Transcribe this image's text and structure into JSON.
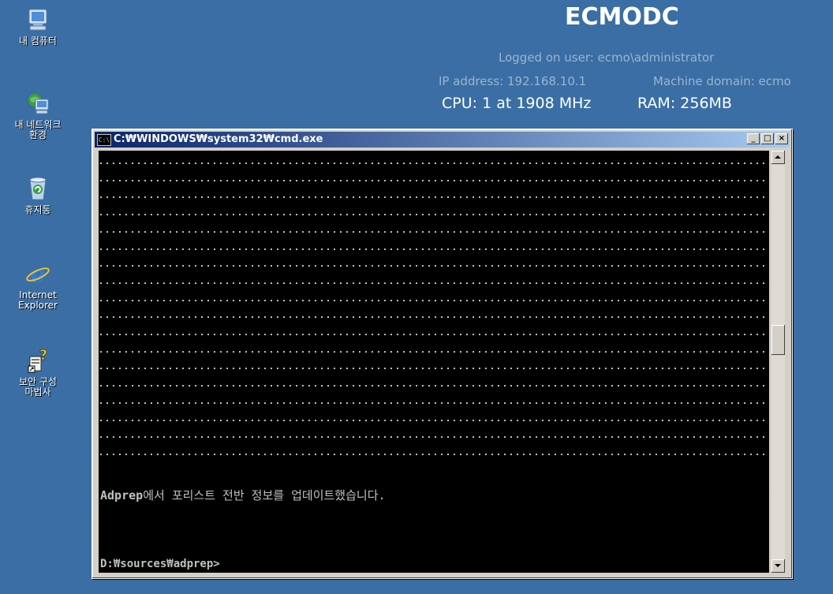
{
  "desktop": {
    "icons": [
      {
        "label": "내 컴퓨터",
        "icon": "my-computer-icon"
      },
      {
        "label": "내 네트워크\n환경",
        "icon": "network-places-icon"
      },
      {
        "label": "휴지통",
        "icon": "recycle-bin-icon"
      },
      {
        "label": "Internet\nExplorer",
        "icon": "internet-explorer-icon"
      },
      {
        "label": "보안 구성\n마법사",
        "icon": "security-wizard-icon"
      }
    ]
  },
  "bginfo": {
    "hostname": "ECMODC",
    "logged_on_user": "Logged on user: ecmo\\administrator",
    "ip_address": "IP address: 192.168.10.1",
    "machine_domain": "Machine domain: ecmo",
    "cpu": "CPU: 1 at 1908 MHz",
    "ram": "RAM: 256MB"
  },
  "window": {
    "title": "C:₩WINDOWS₩system32₩cmd.exe",
    "icon_text": "C:\\",
    "buttons": {
      "minimize": "_",
      "maximize": "□",
      "close": "×"
    }
  },
  "console": {
    "dotted_line_count": 18,
    "message_prefix": "Adprep",
    "message_text": "에서 포리스트 전반 정보를 업데이트했습니다.",
    "prompt": "D:₩sources₩adprep>"
  },
  "scrollbar": {
    "thumb_fraction": 0.44
  },
  "colors": {
    "desktop_background": "#3a6ea5",
    "title_gradient_start": "#0a246a",
    "title_gradient_end": "#a6caf0",
    "console_background": "#000000",
    "console_text": "#c0c0c0"
  }
}
